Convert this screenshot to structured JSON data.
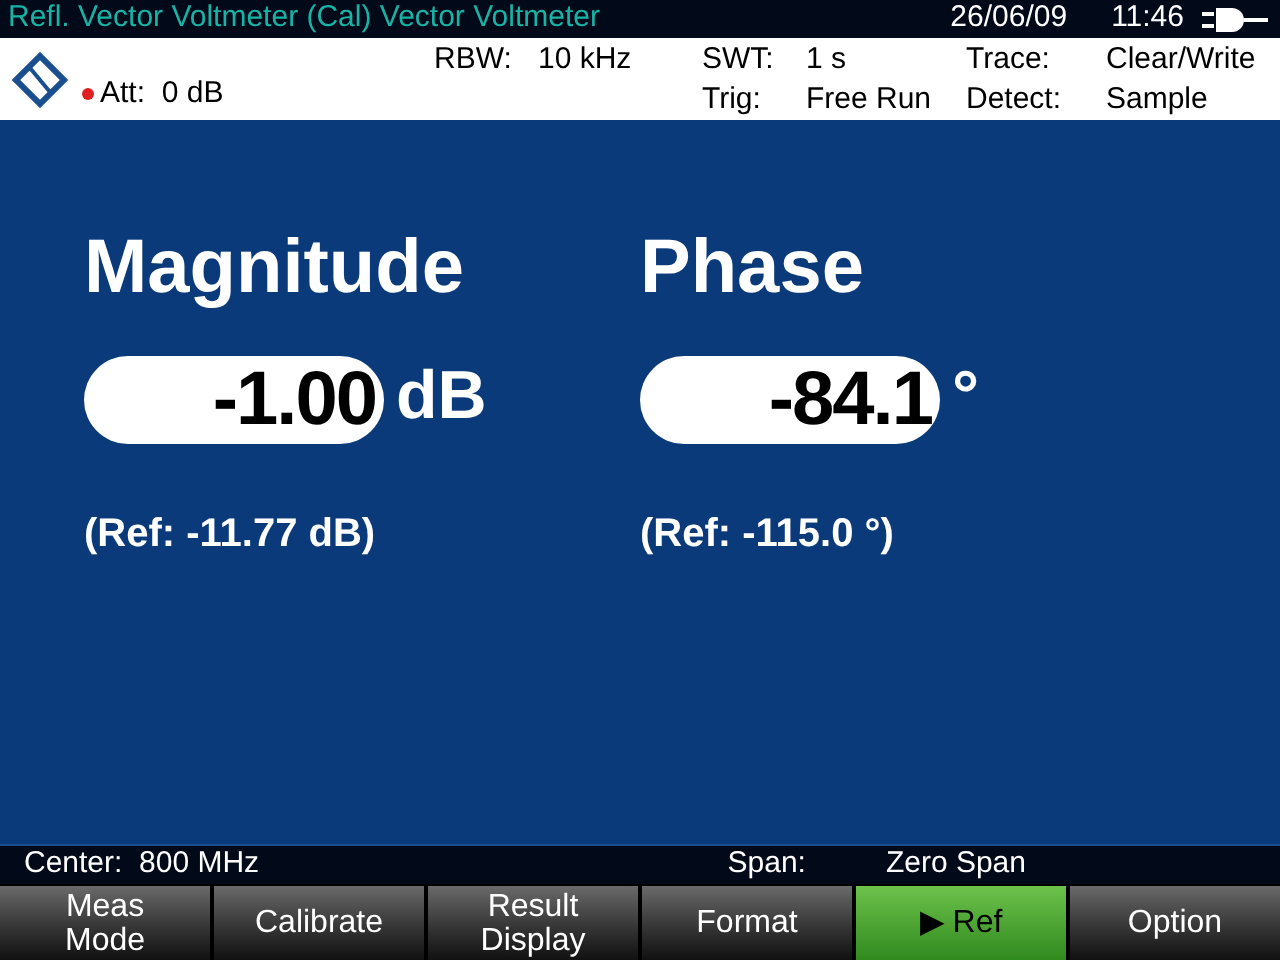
{
  "title_bar": {
    "title": "Refl. Vector Voltmeter (Cal) Vector Voltmeter",
    "date": "26/06/09",
    "time": "11:46"
  },
  "header": {
    "att": "Att:  0 dB",
    "params": [
      {
        "label": "RBW:",
        "value": "10 kHz"
      },
      {
        "label": "SWT:",
        "value": "1 s"
      },
      {
        "label": "Trace:",
        "value": "Clear/Write"
      },
      {
        "label": "Trig:",
        "value": "Free Run"
      },
      {
        "label": "Detect:",
        "value": "Sample"
      }
    ]
  },
  "results": [
    {
      "title": "Magnitude",
      "value": "-1.00",
      "unit": "dB",
      "ref": "(Ref: -11.77 dB)"
    },
    {
      "title": "Phase",
      "value": "-84.1",
      "unit": "°",
      "ref": "(Ref: -115.0 °)"
    }
  ],
  "status_bar": {
    "center": "Center:  800 MHz",
    "span_label": "Span:",
    "span_value": "Zero Span"
  },
  "softkeys": [
    {
      "label": "Meas\nMode",
      "selected": false
    },
    {
      "label": "Calibrate",
      "selected": false
    },
    {
      "label": "Result\nDisplay",
      "selected": false
    },
    {
      "label": "Format",
      "selected": false
    },
    {
      "label": "▶ Ref",
      "selected": true
    },
    {
      "label": "Option",
      "selected": false
    }
  ]
}
